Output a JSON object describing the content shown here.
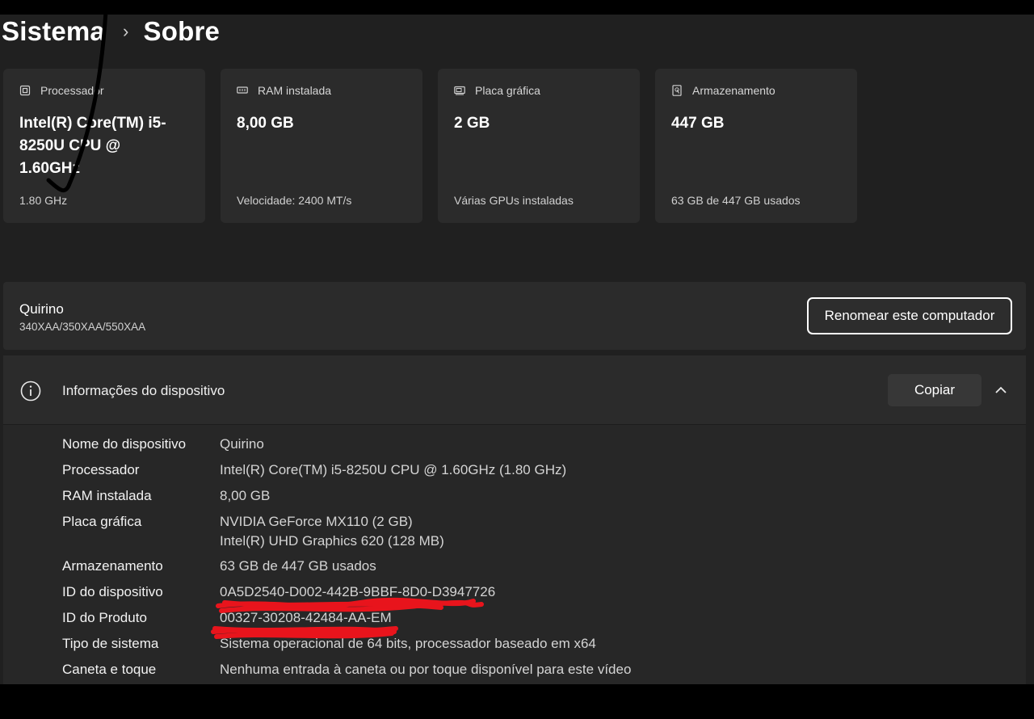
{
  "breadcrumb": {
    "parent": "Sistema",
    "separator": "›",
    "current": "Sobre"
  },
  "specs": [
    {
      "icon": "processor-icon",
      "label": "Processador",
      "value": "Intel(R) Core(TM) i5-8250U CPU @ 1.60GHz",
      "sub": "1.80 GHz"
    },
    {
      "icon": "ram-icon",
      "label": "RAM instalada",
      "value": "8,00 GB",
      "sub": "Velocidade: 2400 MT/s"
    },
    {
      "icon": "gpu-icon",
      "label": "Placa gráfica",
      "value": "2 GB",
      "sub": "Várias GPUs instaladas"
    },
    {
      "icon": "storage-icon",
      "label": "Armazenamento",
      "value": "447 GB",
      "sub": "63 GB de 447 GB usados"
    }
  ],
  "device": {
    "name": "Quirino",
    "model": "340XAA/350XAA/550XAA",
    "rename_label": "Renomear este computador"
  },
  "info": {
    "title": "Informações do dispositivo",
    "copy_label": "Copiar",
    "rows": [
      {
        "label": "Nome do dispositivo",
        "value": "Quirino"
      },
      {
        "label": "Processador",
        "value": "Intel(R) Core(TM) i5-8250U CPU @ 1.60GHz (1.80 GHz)"
      },
      {
        "label": "RAM instalada",
        "value": "8,00 GB"
      },
      {
        "label": "Placa gráfica",
        "value": "NVIDIA GeForce MX110 (2 GB)",
        "value2": "Intel(R) UHD Graphics 620 (128 MB)"
      },
      {
        "label": "Armazenamento",
        "value": "63 GB de 447 GB usados"
      },
      {
        "label": "ID do dispositivo",
        "value": "0A5D2540-D002-442B-9BBF-8D0-D3947726"
      },
      {
        "label": "ID do Produto",
        "value": "00327-30208-42484-AA-EM"
      },
      {
        "label": "Tipo de sistema",
        "value": "Sistema operacional de 64 bits, processador baseado em x64"
      },
      {
        "label": "Caneta e toque",
        "value": "Nenhuma entrada à caneta ou por toque disponível para este vídeo"
      }
    ]
  },
  "colors": {
    "background": "#202020",
    "card": "#2b2b2b",
    "redaction": "#e8141c",
    "annotation": "#000000"
  }
}
